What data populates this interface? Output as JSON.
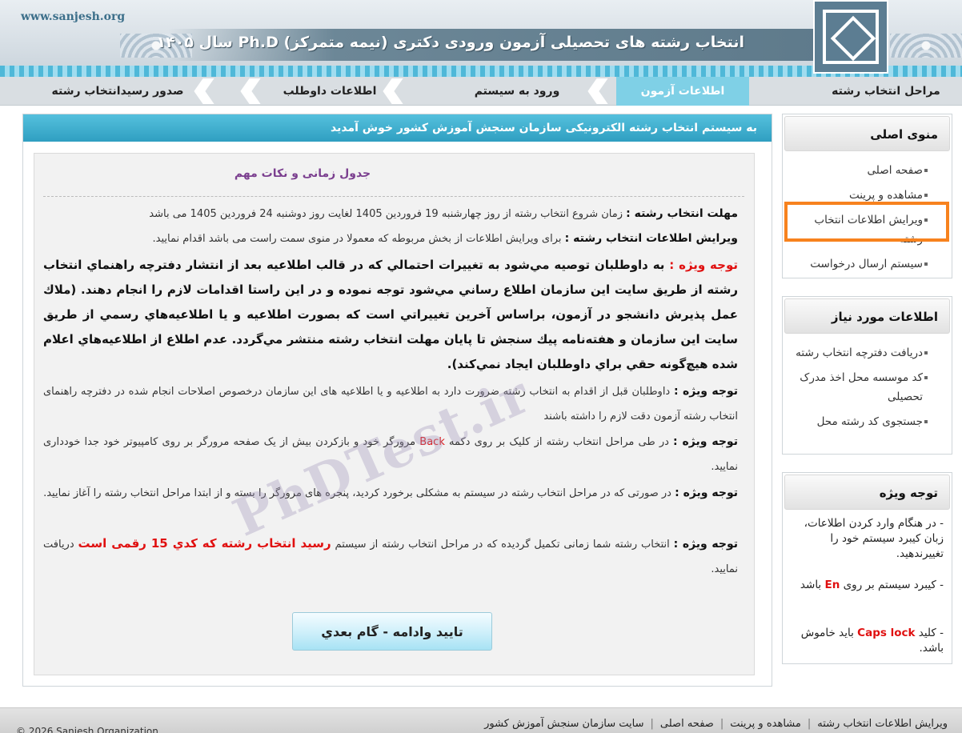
{
  "header": {
    "site_url": "www.sanjesh.org",
    "title": "انتخاب رشته های تحصیلی آزمون ورودی دکتری (نیمه متمرکز) Ph.D سال ۱۴۰۵"
  },
  "nav": {
    "items": [
      {
        "label": "مراحل انتخاب رشته"
      },
      {
        "label": "اطلاعات آزمون"
      },
      {
        "label": "ورود به سیستم"
      },
      {
        "label": "اطلاعات داوطلب"
      },
      {
        "label": "صدور رسیدانتخاب رشته"
      }
    ],
    "active_index": 1
  },
  "main": {
    "welcome": "به سیستم انتخاب رشته الکترونیکی سازمان سنجش آموزش کشور خوش آمدید",
    "content_title": "جدول زمانی و نکات مهم",
    "paragraphs": [
      {
        "label": "مهلت انتخاب رشته :",
        "text": " زمان شروع انتخاب رشته از روز چهارشنبه 19 فروردین 1405 لغایت روز دوشنبه 24 فروردین 1405 می باشد"
      },
      {
        "label": "ویرایش اطلاعات انتخاب رشته :",
        "text": " برای ویرایش اطلاعات از بخش مربوطه که معمولا در منوی سمت راست می باشد اقدام نمایید."
      },
      {
        "label": "توجه ویژه :",
        "text": " به داوطلبان توصيه مي‌شود به تغييرات احتمالي كه در قالب اطلاعيه بعد از انتشار دفترچه راهنماي انتخاب رشته از طريق سايت اين سازمان اطلاع رساني مي‌شود توجه نموده و در اين راستا اقدامات لازم را انجام دهند. (ملاك عمل پذيرش دانشجو در آزمون، براساس آخرين تغييراتي است كه بصورت اطلاعيه و يا اطلاعيه‌هاي رسمي از طريق سايت اين سازمان و هفته‌نامه پيك سنجش تا پايان مهلت انتخاب رشته منتشر مي‌گردد. عدم اطلاع از اطلاعيه‌هاي اعلام شده هيچ‌گونه حقي براي داوطلبان ايجاد نمي‌كند)."
      },
      {
        "label": "توجه ویژه :",
        "text": " داوطلبان قبل از اقدام به انتخاب رشته ضرورت دارد به اطلاعیه و یا اطلاعیه های این سازمان درخصوص اصلاحات انجام شده در دفترچه راهنمای انتخاب رشته آزمون دقت لازم را داشته باشند"
      },
      {
        "label": "توجه ویژه :",
        "text_before": " در طی مراحل انتخاب رشته از کلیک بر روی دکمه ",
        "back": "Back",
        "text_after": " مرورگر خود و بازکردن بیش از یک صفحه مرورگر بر روی کامپیوتر خود جدا خودداری نمایید."
      },
      {
        "label": "توجه ویژه :",
        "text": " در صورتی که در مراحل انتخاب رشته در سیستم به مشکلی برخورد کردید، پنجره های مرورگر را بسته و از ابتدا مراحل انتخاب رشته را آغاز نمایید."
      },
      {
        "label": "توجه ویژه :",
        "text_before": " انتخاب رشته شما زمانی تکمیل گردیده که در مراحل انتخاب رشته از سیستم ",
        "receipt": "رسید انتخاب رشته كه كدي 15 رقمی است",
        "text_after": " دریافت نمایید."
      }
    ],
    "next_button": "تایید وادامه - گام بعدي",
    "watermark": "PhDTest.ir"
  },
  "sidebar": {
    "main_menu": {
      "title": "منوی اصلی",
      "items": [
        {
          "label": "صفحه اصلی"
        },
        {
          "label": "مشاهده و پرینت"
        },
        {
          "label": "ویرایش اطلاعات انتخاب رشته"
        },
        {
          "label": "سیستم ارسال درخواست"
        }
      ]
    },
    "info": {
      "title": "اطلاعات مورد نیاز",
      "items": [
        {
          "label": "دریافت دفترچه انتخاب رشته"
        },
        {
          "label": "کد موسسه محل اخذ مدرک تحصیلی"
        },
        {
          "label": "جستجوی کد رشته محل"
        }
      ]
    },
    "notice": {
      "title": "توجه ویژه",
      "line1": "- در هنگام وارد کردن اطلاعات، زبان کیبرد سیستم خود را تغییرندهید.",
      "line2_before": "- کیبرد سیستم بر روی ",
      "line2_en": "En",
      "line2_after": " باشد",
      "line3_before": "- کلید ",
      "line3_en": "Caps lock",
      "line3_after": " باید خاموش باشد."
    }
  },
  "footer": {
    "links": [
      "ویرایش اطلاعات انتخاب رشته",
      "مشاهده و پرینت",
      "صفحه اصلی",
      "سایت سازمان سنجش آموزش کشور"
    ],
    "copyright": "© 2026 Sanjesh Organization"
  },
  "colors": {
    "accent": "#2f9fc1",
    "nav_active": "#7fd0e6",
    "highlight": "#f7821e",
    "alert_red": "#e01010",
    "title_purple": "#7b3f8f"
  }
}
